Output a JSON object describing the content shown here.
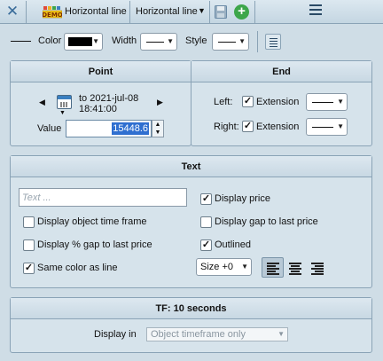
{
  "titlebar": {
    "close_icon": "close-icon",
    "demo_badge": "DEMO",
    "object_name": "Horizontal line",
    "object_type": "Horizontal line",
    "save_icon": "floppy-disk-icon",
    "add_icon": "plus-circle-icon",
    "menu_icon": "hamburger-menu-icon"
  },
  "toolbar": {
    "color_label": "Color",
    "color_value": "#000000",
    "width_label": "Width",
    "style_label": "Style",
    "list_icon": "list-icon"
  },
  "point": {
    "header": "Point",
    "date_line1": "to 2021-jul-08",
    "date_line2": "18:41:00",
    "value_label": "Value",
    "value": "15448.6"
  },
  "end": {
    "header": "End",
    "left_label": "Left:",
    "left_extension_label": "Extension",
    "left_extension_checked": true,
    "right_label": "Right:",
    "right_extension_label": "Extension",
    "right_extension_checked": true
  },
  "text": {
    "header": "Text",
    "placeholder": "Text ...",
    "display_price": "Display price",
    "display_price_checked": true,
    "display_timeframe": "Display object time frame",
    "display_timeframe_checked": false,
    "display_gap": "Display gap to last price",
    "display_gap_checked": false,
    "display_pct_gap": "Display % gap to last price",
    "display_pct_gap_checked": false,
    "outlined": "Outlined",
    "outlined_checked": true,
    "same_color": "Same color as line",
    "same_color_checked": true,
    "size": "Size +0",
    "active_alignment": "left"
  },
  "tf": {
    "header": "TF: 10 seconds",
    "display_in_label": "Display in",
    "display_in_value": "Object timeframe only"
  }
}
